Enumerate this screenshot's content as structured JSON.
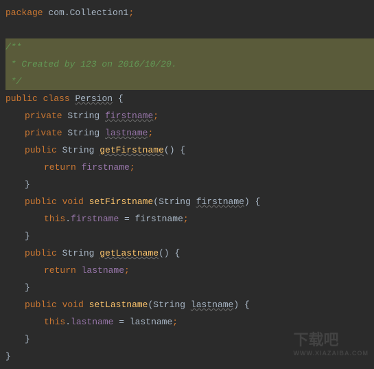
{
  "code": {
    "package_kw": "package",
    "package_name": " com.Collection1",
    "semi": ";",
    "doc_open": "/**",
    "doc_line": " * Created by 123 on 2016/10/20.",
    "doc_close": " */",
    "public_kw": "public",
    "private_kw": "private",
    "class_kw": "class",
    "void_kw": "void",
    "return_kw": "return",
    "this_kw": "this",
    "string_type": "String",
    "class_name": "Persion",
    "field_firstname": "firstname",
    "field_lastname": "lastname",
    "m_getFirstname": "getFirstname",
    "m_setFirstname": "setFirstname",
    "m_getLastname": "getLastname",
    "m_setLastname": "setLastname",
    "param_firstname": "firstname",
    "param_lastname": "lastname",
    "lparen": "(",
    "rparen": ")",
    "lbrace": "{",
    "rbrace": "}",
    "dot": ".",
    "eq": " = ",
    "sp": " "
  },
  "watermark": {
    "main": "下载吧",
    "sub": "WWW.XIAZAIBA.COM"
  }
}
